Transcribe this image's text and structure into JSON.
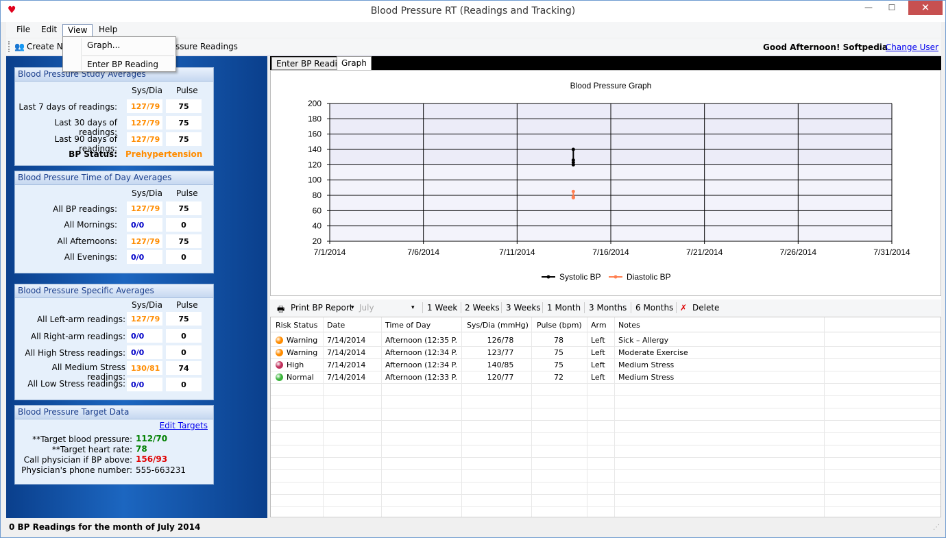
{
  "window": {
    "title": "Blood Pressure RT (Readings and Tracking)"
  },
  "menu": {
    "file": "File",
    "edit": "Edit",
    "view": "View",
    "help": "Help"
  },
  "view_menu": {
    "graph": "Graph...",
    "enter_bp": "Enter BP Reading"
  },
  "toolbar": {
    "create": "Create Ne",
    "readings": "ssure Readings",
    "greeting": "Good Afternoon! Softpedia",
    "change_user": "Change User"
  },
  "study": {
    "title": "Blood Pressure Study Averages",
    "col_sysdia": "Sys/Dia",
    "col_pulse": "Pulse",
    "rows": [
      {
        "label": "Last 7 days of readings:",
        "sysdia": "127/79",
        "pulse": "75"
      },
      {
        "label": "Last 30 days of readings:",
        "sysdia": "127/79",
        "pulse": "75"
      },
      {
        "label": "Last 90 days of readings:",
        "sysdia": "127/79",
        "pulse": "75"
      }
    ],
    "status_label": "BP Status:",
    "status_value": "Prehypertension"
  },
  "timeofday": {
    "title": "Blood Pressure Time of Day Averages",
    "col_sysdia": "Sys/Dia",
    "col_pulse": "Pulse",
    "rows": [
      {
        "label": "All BP readings:",
        "sysdia": "127/79",
        "pulse": "75"
      },
      {
        "label": "All Mornings:",
        "sysdia": "0/0",
        "pulse": "0"
      },
      {
        "label": "All Afternoons:",
        "sysdia": "127/79",
        "pulse": "75"
      },
      {
        "label": "All Evenings:",
        "sysdia": "0/0",
        "pulse": "0"
      }
    ]
  },
  "specific": {
    "title": "Blood Pressure Specific Averages",
    "col_sysdia": "Sys/Dia",
    "col_pulse": "Pulse",
    "rows": [
      {
        "label": "All Left-arm readings:",
        "sysdia": "127/79",
        "pulse": "75"
      },
      {
        "label": "All Right-arm readings:",
        "sysdia": "0/0",
        "pulse": "0"
      },
      {
        "label": "All High Stress readings:",
        "sysdia": "0/0",
        "pulse": "0"
      },
      {
        "label": "All Medium Stress readings:",
        "sysdia": "130/81",
        "pulse": "74"
      },
      {
        "label": "All Low Stress readings:",
        "sysdia": "0/0",
        "pulse": "0"
      }
    ]
  },
  "target": {
    "title": "Blood Pressure Target Data",
    "edit": "Edit Targets",
    "bp_label": "**Target blood pressure:",
    "bp_value": "112/70",
    "hr_label": "**Target heart rate:",
    "hr_value": "78",
    "call_label": "Call physician if BP above:",
    "call_value": "156/93",
    "phone_label": "Physician's phone number:",
    "phone_value": "555-663231"
  },
  "tabs": {
    "enter": "Enter BP Reading",
    "graph": "Graph"
  },
  "chart_data": {
    "type": "scatter",
    "title": "Blood Pressure Graph",
    "ylim": [
      20,
      200
    ],
    "yticks": [
      "200",
      "180",
      "160",
      "140",
      "120",
      "100",
      "80",
      "60",
      "40",
      "20"
    ],
    "xticks": [
      "7/1/2014",
      "7/6/2014",
      "7/11/2014",
      "7/16/2014",
      "7/21/2014",
      "7/26/2014",
      "7/31/2014"
    ],
    "grid": true,
    "legend_position": "bottom",
    "series": [
      {
        "name": "Systolic BP",
        "color": "#000000",
        "x": [
          "7/14/2014",
          "7/14/2014",
          "7/14/2014",
          "7/14/2014"
        ],
        "values": [
          126,
          123,
          140,
          120
        ]
      },
      {
        "name": "Diastolic BP",
        "color": "#ff7f50",
        "x": [
          "7/14/2014",
          "7/14/2014",
          "7/14/2014",
          "7/14/2014"
        ],
        "values": [
          78,
          77,
          85,
          77
        ]
      }
    ]
  },
  "graph_toolbar": {
    "print": "Print BP Report",
    "month": "July",
    "w1": "1 Week",
    "w2": "2 Weeks",
    "w3": "3 Weeks",
    "m1": "1 Month",
    "m3": "3 Months",
    "m6": "6 Months",
    "delete": "Delete"
  },
  "grid": {
    "headers": [
      "Risk Status",
      "Date",
      "Time of Day",
      "Sys/Dia (mmHg)",
      "Pulse (bpm)",
      "Arm",
      "Notes"
    ],
    "rows": [
      {
        "status": "Warning",
        "color": "#ff8c00",
        "date": "7/14/2014",
        "time": "Afternoon (12:35 P...",
        "sysdia": "126/78",
        "pulse": "78",
        "arm": "Left",
        "notes": "Sick – Allergy"
      },
      {
        "status": "Warning",
        "color": "#ff8c00",
        "date": "7/14/2014",
        "time": "Afternoon (12:34 P...",
        "sysdia": "123/77",
        "pulse": "75",
        "arm": "Left",
        "notes": "Moderate Exercise"
      },
      {
        "status": "High",
        "color": "#c0305c",
        "date": "7/14/2014",
        "time": "Afternoon (12:34 P...",
        "sysdia": "140/85",
        "pulse": "75",
        "arm": "Left",
        "notes": "Medium Stress"
      },
      {
        "status": "Normal",
        "color": "#3cb43c",
        "date": "7/14/2014",
        "time": "Afternoon (12:33 P...",
        "sysdia": "120/77",
        "pulse": "72",
        "arm": "Left",
        "notes": "Medium Stress"
      }
    ]
  },
  "status": {
    "text": "0 BP Readings for the month of July 2014"
  }
}
